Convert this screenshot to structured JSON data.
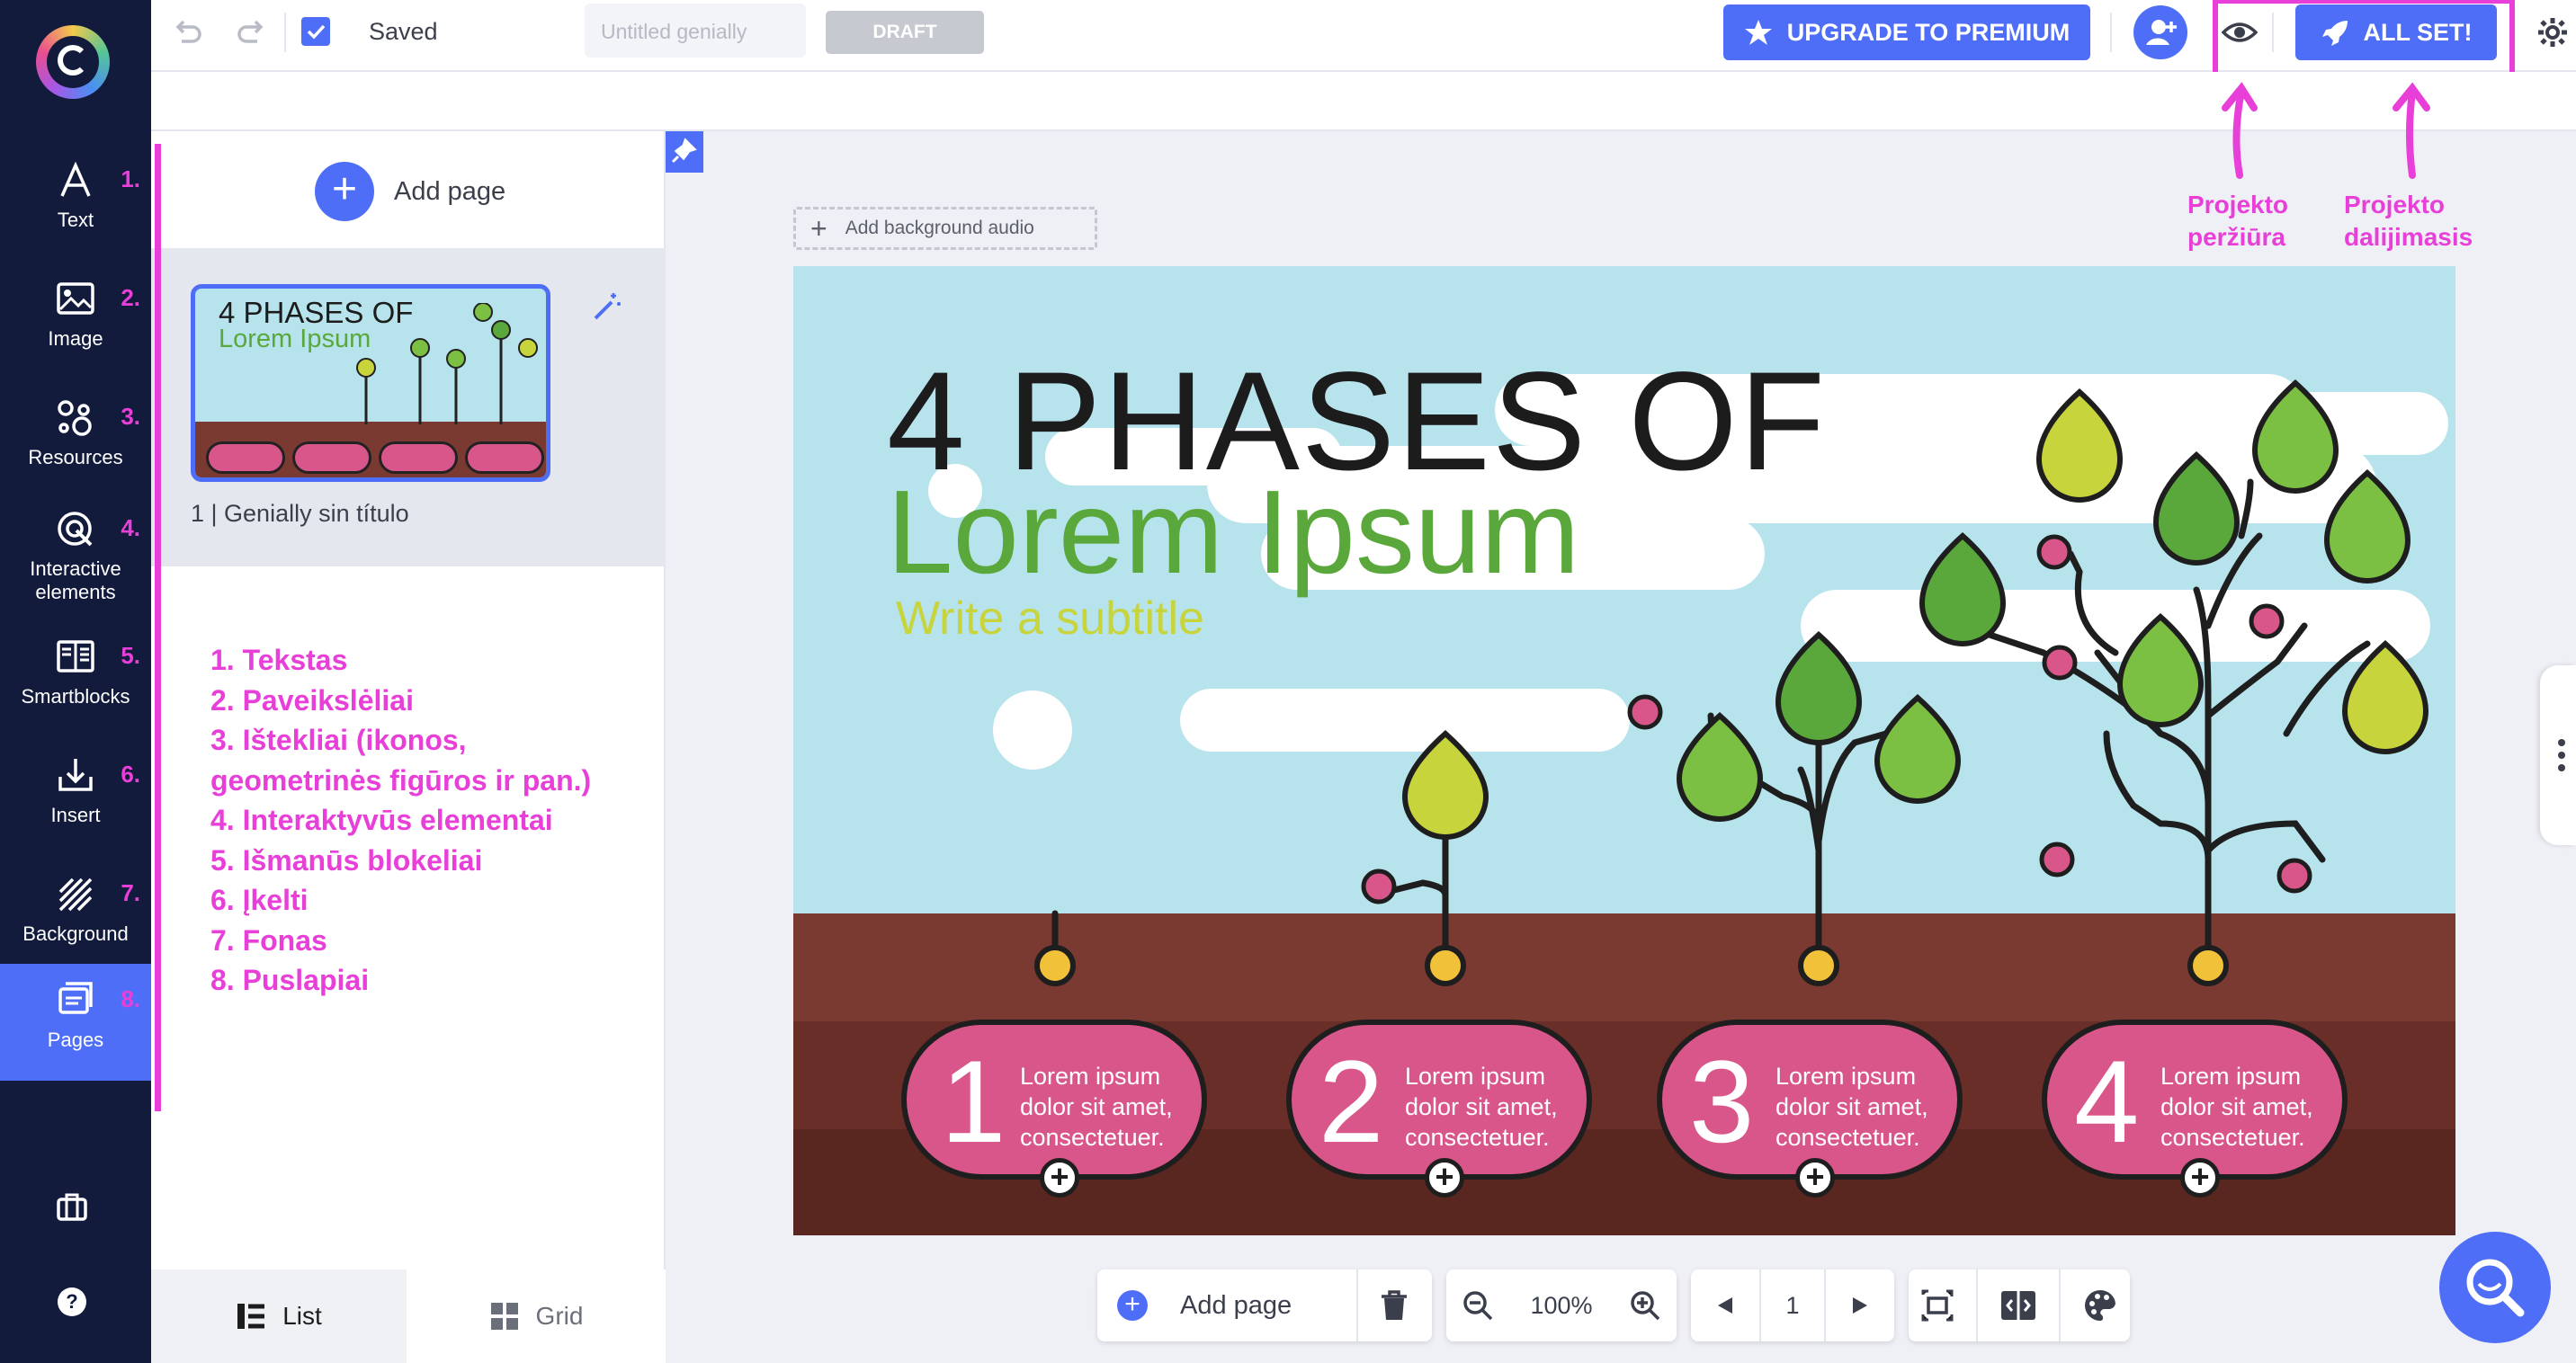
{
  "sidebar": {
    "items": [
      {
        "label": "Text",
        "num": "1."
      },
      {
        "label": "Image",
        "num": "2."
      },
      {
        "label": "Resources",
        "num": "3."
      },
      {
        "label": "Interactive elements",
        "num": "4."
      },
      {
        "label": "Smartblocks",
        "num": "5."
      },
      {
        "label": "Insert",
        "num": "6."
      },
      {
        "label": "Background",
        "num": "7."
      },
      {
        "label": "Pages",
        "num": "8."
      }
    ]
  },
  "topbar": {
    "saved_label": "Saved",
    "title_placeholder": "Untitled genially",
    "draft_label": "DRAFT",
    "upgrade_label": "UPGRADE TO PREMIUM",
    "allset_label": "ALL SET!"
  },
  "annotations": {
    "preview": [
      "Projekto",
      "peržiūra"
    ],
    "share": [
      "Projekto",
      "dalijimasis"
    ],
    "legend": [
      "1. Tekstas",
      "2. Paveikslėliai",
      "3. Ištekliai (ikonos,",
      "geometrinės figūros ir pan.)",
      "4. Interaktyvūs elementai",
      "5. Išmanūs blokeliai",
      "6. Įkelti",
      "7. Fonas",
      "8. Puslapiai"
    ]
  },
  "pages_panel": {
    "add_page_label": "Add page",
    "page_caption": "1 | Genially sin título",
    "thumb_title": "4 PHASES OF",
    "thumb_subtitle": "Lorem Ipsum",
    "view_list": "List",
    "view_grid": "Grid"
  },
  "canvas": {
    "add_audio_label": "Add background audio",
    "title": "4 PHASES OF",
    "subtitle": "Lorem Ipsum",
    "tagline": "Write a subtitle",
    "phases": [
      {
        "num": "1",
        "text": [
          "Lorem ipsum",
          "dolor sit amet,",
          "consectetuer."
        ]
      },
      {
        "num": "2",
        "text": [
          "Lorem ipsum",
          "dolor sit amet,",
          "consectetuer."
        ]
      },
      {
        "num": "3",
        "text": [
          "Lorem ipsum",
          "dolor sit amet,",
          "consectetuer."
        ]
      },
      {
        "num": "4",
        "text": [
          "Lorem ipsum",
          "dolor sit amet,",
          "consectetuer."
        ]
      }
    ]
  },
  "bottom_toolbar": {
    "add_page_label": "Add page",
    "zoom": "100%",
    "page_number": "1"
  },
  "colors": {
    "accent": "#4f6ef7",
    "sidebar": "#131b3d",
    "annotation": "#e83fd9",
    "phase_pink": "#d9568a",
    "soil": "#7a3a32"
  }
}
